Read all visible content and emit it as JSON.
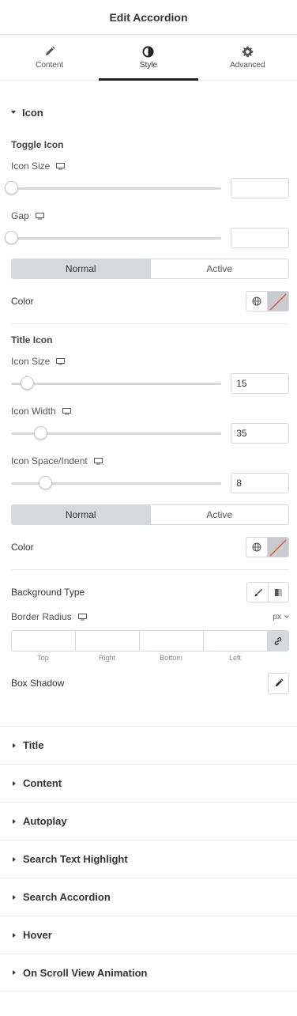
{
  "header": {
    "title": "Edit Accordion"
  },
  "tabs": [
    {
      "label": "Content",
      "icon": "pencil-icon",
      "active": false
    },
    {
      "label": "Style",
      "icon": "contrast-icon",
      "active": true
    },
    {
      "label": "Advanced",
      "icon": "gear-icon",
      "active": false
    }
  ],
  "icon_section": {
    "title": "Icon",
    "toggle_icon": {
      "heading": "Toggle Icon",
      "icon_size": {
        "label": "Icon Size",
        "value": "",
        "slider_fraction": 0
      },
      "gap": {
        "label": "Gap",
        "value": "",
        "slider_fraction": 0
      },
      "state_tabs": {
        "normal": "Normal",
        "active": "Active",
        "selected": "Normal"
      },
      "color_label": "Color"
    },
    "title_icon": {
      "heading": "Title Icon",
      "icon_size": {
        "label": "Icon Size",
        "value": "15",
        "slider_fraction": 0.075
      },
      "icon_width": {
        "label": "Icon Width",
        "value": "35",
        "slider_fraction": 0.14
      },
      "icon_space": {
        "label": "Icon Space/Indent",
        "value": "8",
        "slider_fraction": 0.16
      },
      "state_tabs": {
        "normal": "Normal",
        "active": "Active",
        "selected": "Normal"
      },
      "color_label": "Color"
    },
    "background_type_label": "Background Type",
    "border_radius": {
      "label": "Border Radius",
      "unit": "px",
      "sides": [
        "Top",
        "Right",
        "Bottom",
        "Left"
      ]
    },
    "box_shadow_label": "Box Shadow"
  },
  "collapsed_sections": [
    "Title",
    "Content",
    "Autoplay",
    "Search Text Highlight",
    "Search Accordion",
    "Hover",
    "On Scroll View Animation"
  ],
  "colors": {
    "active_tab_underline": "#1f2124",
    "border": "#d5d8dc",
    "toggle_selected": "#d5d8dc",
    "swatch_slash": "#e2574c"
  }
}
